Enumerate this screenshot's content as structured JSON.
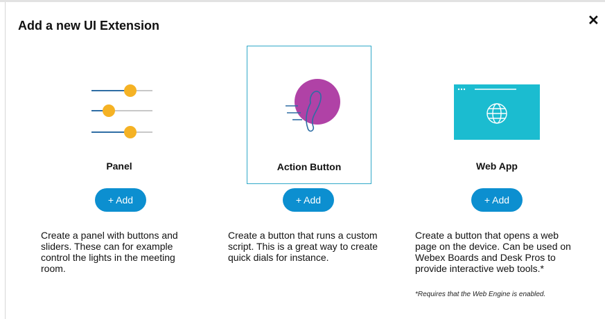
{
  "dialog": {
    "title": "Add a new UI Extension",
    "close_glyph": "✕"
  },
  "cards": [
    {
      "label": "Panel",
      "icon": "sliders-icon",
      "add_label": "+ Add",
      "selected": false,
      "description": "Create a panel with buttons and sliders. These can for example control the lights in the meeting room."
    },
    {
      "label": "Action Button",
      "icon": "phone-dial-icon",
      "add_label": "+ Add",
      "selected": true,
      "description": "Create a button that runs a custom script. This is a great way to create quick dials for instance."
    },
    {
      "label": "Web App",
      "icon": "web-browser-icon",
      "add_label": "+ Add",
      "selected": false,
      "description": "Create a button that opens a web page on the device. Can be used on Webex Boards and Desk Pros to provide interactive web tools.*"
    }
  ],
  "footnote": "*Requires that the Web Engine is enabled.",
  "colors": {
    "accent_button": "#0c8fd0",
    "slider_knob": "#f5b224",
    "slider_track": "#2e6da4",
    "action_circle": "#b042a6",
    "webapp_bg": "#1bbcd0",
    "selected_border": "#2fa8c8"
  }
}
